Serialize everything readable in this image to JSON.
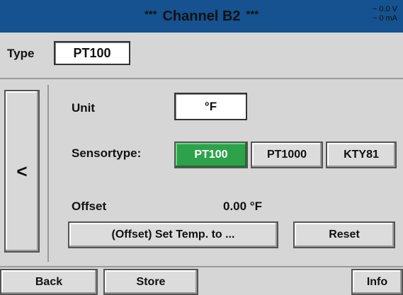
{
  "header": {
    "title": "Channel B2",
    "stars_left": "***",
    "stars_right": "***",
    "status_voltage": "~ 0.0 V",
    "status_current": "~ 0 mA"
  },
  "type": {
    "label": "Type",
    "value": "PT100"
  },
  "nav": {
    "left_symbol": "<"
  },
  "unit": {
    "label": "Unit",
    "value": "°F"
  },
  "sensor": {
    "label": "Sensortype:",
    "options": [
      "PT100",
      "PT1000",
      "KTY81"
    ],
    "selected": "PT100"
  },
  "offset": {
    "label": "Offset",
    "value": "0.00 °F",
    "set_label": "(Offset) Set Temp. to ...",
    "reset_label": "Reset"
  },
  "footer": {
    "back": "Back",
    "store": "Store",
    "info": "Info"
  },
  "colors": {
    "header_bg": "#15528f",
    "active_green": "#2ea24a",
    "background": "#d6d6d6"
  }
}
